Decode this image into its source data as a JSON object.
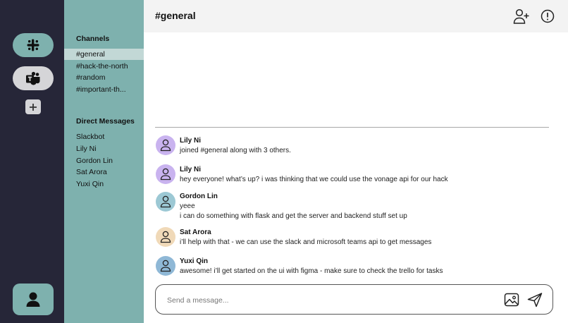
{
  "workspaces": {
    "items": [
      {
        "name": "slack",
        "icon": "slack-logo-icon"
      },
      {
        "name": "teams",
        "icon": "teams-logo-icon"
      }
    ],
    "add_icon": "plus-icon",
    "profile_icon": "user-icon"
  },
  "sidebar": {
    "channels_title": "Channels",
    "channels": [
      "#general",
      "#hack-the-north",
      "#random",
      "#important-th..."
    ],
    "active_channel_index": 0,
    "dm_title": "Direct Messages",
    "direct_messages": [
      "Slackbot",
      "Lily Ni",
      "Gordon Lin",
      "Sat Arora",
      "Yuxi Qin"
    ]
  },
  "header": {
    "title": "#general",
    "icons": [
      "add-user-icon",
      "alert-icon"
    ]
  },
  "messages": [
    {
      "author": "Lily Ni",
      "avatar_color": "#c9b3ef",
      "lines": [
        "joined #general along with 3 others."
      ]
    },
    {
      "author": "Lily Ni",
      "avatar_color": "#c9b3ef",
      "lines": [
        "hey everyone! what’s up? i was thinking that we could use the vonage api for our hack"
      ]
    },
    {
      "author": "Gordon Lin",
      "avatar_color": "#9cc8d4",
      "lines": [
        "yeee",
        "i can do something with flask and get the server and backend stuff set up"
      ]
    },
    {
      "author": "Sat Arora",
      "avatar_color": "#f0d9b8",
      "lines": [
        "i’ll help with that - we can use the slack and microsoft teams api to get messages"
      ]
    },
    {
      "author": "Yuxi Qin",
      "avatar_color": "#8fb8d6",
      "lines": [
        "awesome! i’ll get started on the ui with figma - make sure to check the trello for tasks"
      ]
    }
  ],
  "composer": {
    "placeholder": "Send a message...",
    "icons": [
      "image-icon",
      "send-icon"
    ]
  },
  "colors": {
    "rail_bg": "#262638",
    "sidebar_bg": "#7eb1ae",
    "active_item_bg": "#c2d8d6",
    "header_bg": "#f3f3f3"
  }
}
